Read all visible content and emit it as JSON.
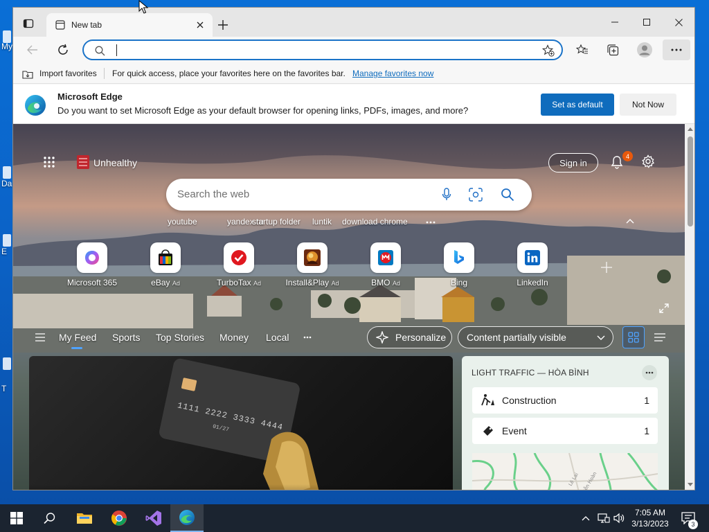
{
  "desktop": {
    "icon_labels": [
      "My",
      "Da",
      "E",
      "T"
    ]
  },
  "browser": {
    "tab": {
      "title": "New tab"
    },
    "address": {
      "value": "",
      "placeholder": ""
    },
    "favorites_bar": {
      "import_label": "Import favorites",
      "message": "For quick access, place your favorites here on the favorites bar.",
      "manage_link": "Manage favorites now"
    },
    "infobar": {
      "title": "Microsoft Edge",
      "message": "Do you want to set Microsoft Edge as your default browser for opening links, PDFs, images, and more?",
      "primary_button": "Set as default",
      "secondary_button": "Not Now"
    }
  },
  "newtab": {
    "brand": "Unhealthy",
    "sign_in": "Sign in",
    "notification_count": "4",
    "search_placeholder": "Search the web",
    "suggestions": [
      "youtube",
      "yandex.ru",
      "startup folder",
      "luntik",
      "download chrome"
    ],
    "quick_links": [
      {
        "label": "Microsoft 365",
        "ad": "",
        "icon": "microsoft-365-icon"
      },
      {
        "label": "eBay",
        "ad": "Ad",
        "icon": "ebay-icon"
      },
      {
        "label": "TurboTax",
        "ad": "Ad",
        "icon": "turbotax-icon"
      },
      {
        "label": "Install&Play",
        "ad": "Ad",
        "icon": "install-play-icon"
      },
      {
        "label": "BMO",
        "ad": "Ad",
        "icon": "bmo-icon"
      },
      {
        "label": "Bing",
        "ad": "",
        "icon": "bing-icon"
      },
      {
        "label": "LinkedIn",
        "ad": "",
        "icon": "linkedin-icon"
      }
    ],
    "feed_tabs": [
      "My Feed",
      "Sports",
      "Top Stories",
      "Money",
      "Local"
    ],
    "personalize": "Personalize",
    "content_visibility": "Content partially visible",
    "traffic": {
      "title": "LIGHT TRAFFIC — HÒA BÌNH",
      "rows": [
        {
          "name": "Construction",
          "count": "1"
        },
        {
          "name": "Event",
          "count": "1"
        }
      ],
      "map_labels": [
        "Lê Lai",
        "Nguyễn Hoàn"
      ]
    }
  },
  "taskbar": {
    "time": "7:05 AM",
    "date": "3/13/2023",
    "notifications": "3"
  },
  "colors": {
    "accent": "#0f6cbd",
    "desktop": "#0b63c8",
    "taskbar": "#1b2430",
    "badge": "#e8590c"
  }
}
